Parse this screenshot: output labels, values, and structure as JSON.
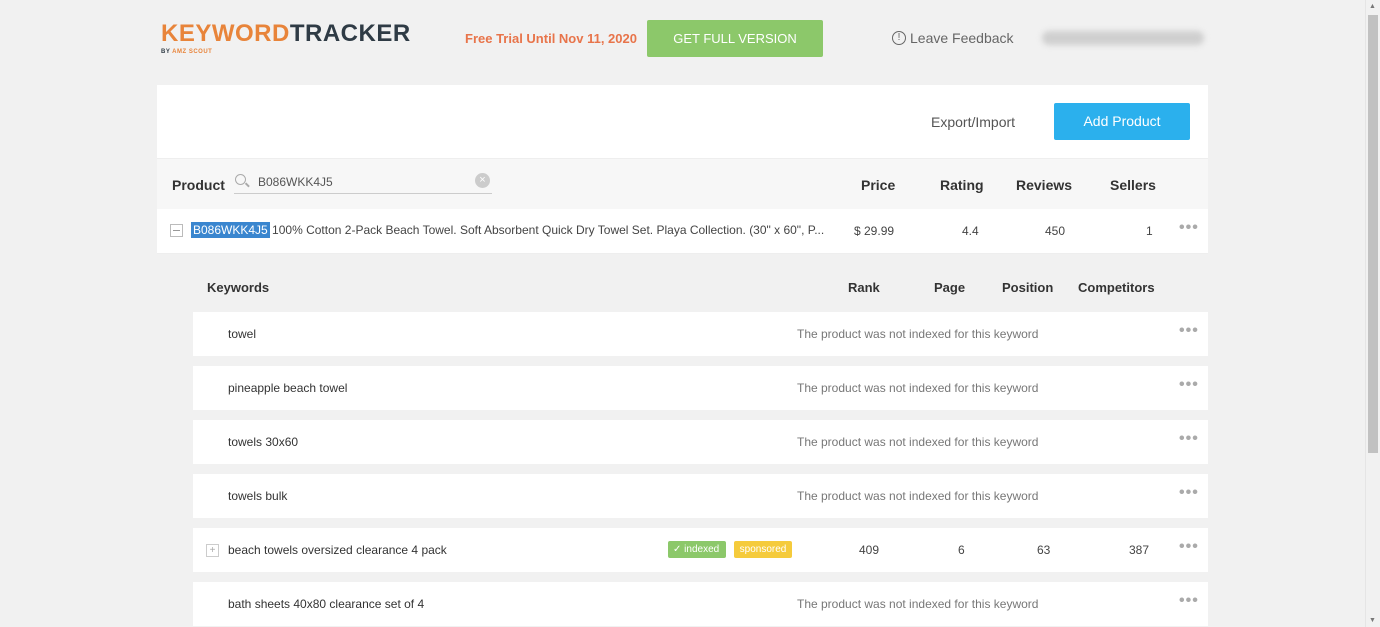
{
  "header": {
    "logo_part1": "KEYW",
    "logo_part2": "O",
    "logo_part3": "RD",
    "logo_part4": "TRACKER",
    "logo_sub_by": "BY ",
    "logo_sub_brand": "AMZ SCOUT",
    "trial_text": "Free Trial Until Nov 11, 2020",
    "get_full_label": "GET FULL VERSION",
    "feedback_icon": "info-icon",
    "feedback_label": "Leave Feedback",
    "colors": {
      "accent_orange": "#e8843a",
      "green": "#8cc86a",
      "blue": "#2bb0ed"
    }
  },
  "toolbar": {
    "export_label": "Export/Import",
    "add_product_label": "Add Product"
  },
  "product_table": {
    "headers": {
      "product": "Product",
      "price": "Price",
      "rating": "Rating",
      "reviews": "Reviews",
      "sellers": "Sellers"
    },
    "search_value": "B086WKK4J5",
    "rows": [
      {
        "asin": "B086WKK4J5",
        "title": " 100% Cotton 2-Pack Beach Towel. Soft Absorbent Quick Dry Towel Set. Playa Collection. (30\" x 60\", P...",
        "price": "$ 29.99",
        "rating": "4.4",
        "reviews": "450",
        "sellers": "1"
      }
    ]
  },
  "keywords_table": {
    "headers": {
      "keywords": "Keywords",
      "rank": "Rank",
      "page": "Page",
      "position": "Position",
      "competitors": "Competitors"
    },
    "not_indexed_text": "The product was not indexed for this keyword",
    "rows": [
      {
        "keyword": "towel",
        "indexed": false
      },
      {
        "keyword": "pineapple beach towel",
        "indexed": false
      },
      {
        "keyword": "towels 30x60",
        "indexed": false
      },
      {
        "keyword": "towels bulk",
        "indexed": false
      },
      {
        "keyword": "beach towels oversized clearance 4 pack",
        "indexed": true,
        "badge_indexed": "✓ indexed",
        "badge_sponsored": "sponsored",
        "rank": "409",
        "page": "6",
        "position": "63",
        "competitors": "387"
      },
      {
        "keyword": "bath sheets 40x80 clearance set of 4",
        "indexed": false
      }
    ]
  },
  "more_icon": "•••"
}
